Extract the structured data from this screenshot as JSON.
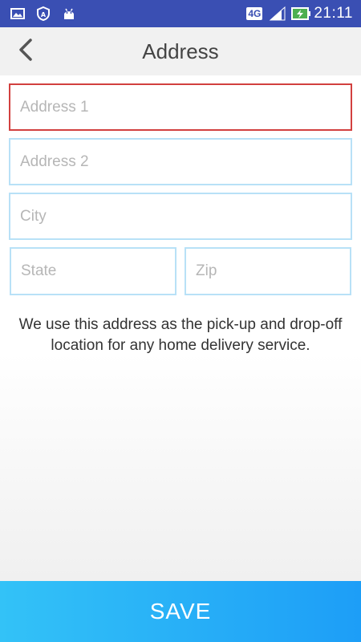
{
  "status_bar": {
    "network": "4G",
    "time": "21:11",
    "icons": [
      "image-icon",
      "shield-icon",
      "android-icon",
      "signal-icon",
      "battery-charging-icon"
    ]
  },
  "header": {
    "title": "Address",
    "back_icon": "chevron-left-icon"
  },
  "form": {
    "address1": {
      "placeholder": "Address 1",
      "value": ""
    },
    "address2": {
      "placeholder": "Address 2",
      "value": ""
    },
    "city": {
      "placeholder": "City",
      "value": ""
    },
    "state": {
      "placeholder": "State",
      "value": ""
    },
    "zip": {
      "placeholder": "Zip",
      "value": ""
    },
    "focused_border_color": "#d2403f",
    "border_color": "#b8e1f7"
  },
  "info_text": "We use this address as the pick-up and drop-off location for any home delivery service.",
  "save_button": {
    "label": "SAVE",
    "colors": [
      "#33c2f7",
      "#1d9ef7"
    ]
  }
}
